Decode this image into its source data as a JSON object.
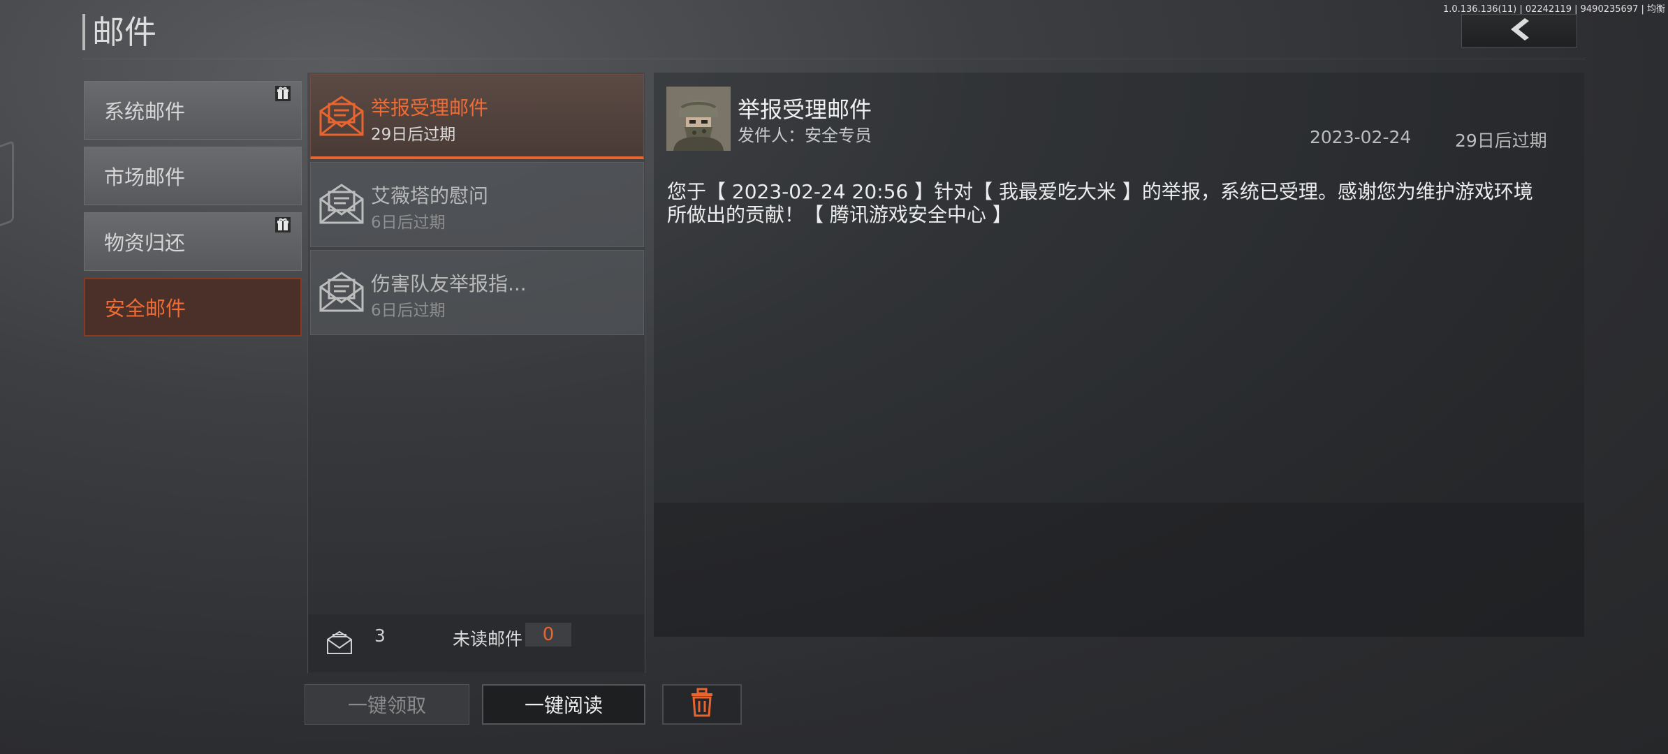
{
  "version": "1.0.136.136(11) | 02242119 | 9490235697 | 均衡",
  "header": {
    "title": "邮件",
    "back_icon": "chevron-left-icon"
  },
  "categories": [
    {
      "label": "系统邮件",
      "gift_badge": true
    },
    {
      "label": "市场邮件",
      "gift_badge": false
    },
    {
      "label": "物资归还",
      "gift_badge": true
    },
    {
      "label": "安全邮件",
      "gift_badge": false,
      "selected": true
    }
  ],
  "mails": [
    {
      "title": "举报受理邮件",
      "expire": "29日后过期",
      "selected": true
    },
    {
      "title": "艾薇塔的慰问",
      "expire": "6日后过期"
    },
    {
      "title": "伤害队友举报指...",
      "expire": "6日后过期"
    }
  ],
  "footer": {
    "count": "3",
    "unread_label": "未读邮件",
    "unread_count": "0"
  },
  "buttons": {
    "claim_all": "一键领取",
    "read_all": "一键阅读",
    "delete_icon": "trash-icon"
  },
  "detail": {
    "title": "举报受理邮件",
    "sender": "发件人：安全专员",
    "date": "2023-02-24",
    "expire": "29日后过期",
    "body": "您于【 2023-02-24 20:56 】针对【 我最爱吃大米 】的举报，系统已受理。感谢您为维护游戏环境所做出的贡献！【 腾讯游戏安全中心 】"
  },
  "colors": {
    "accent": "#e8652f",
    "accent_text": "#ee6b36"
  }
}
